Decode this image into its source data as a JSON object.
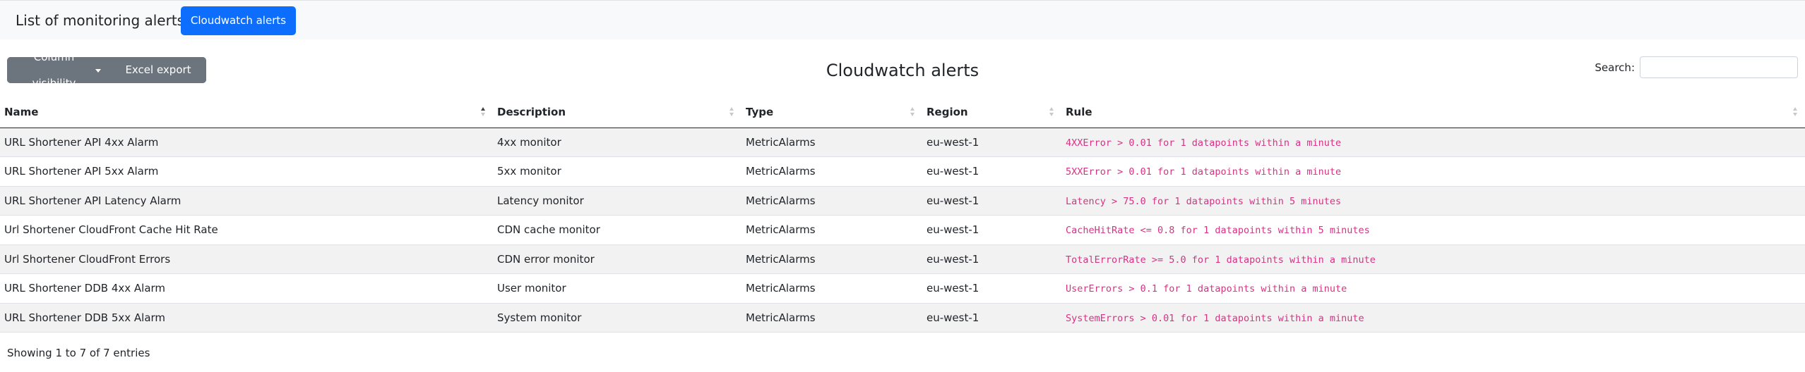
{
  "navbar": {
    "brand": "List of monitoring alerts",
    "nav_button": "Cloudwatch alerts"
  },
  "toolbar": {
    "column_visibility_label": "Column visibility",
    "excel_export_label": "Excel export"
  },
  "table_title": "Cloudwatch alerts",
  "search": {
    "label": "Search:",
    "value": ""
  },
  "table": {
    "columns": [
      "Name",
      "Description",
      "Type",
      "Region",
      "Rule"
    ],
    "sorted_column": "Name",
    "sort_direction": "asc",
    "rows": [
      [
        "URL Shortener API 4xx Alarm",
        "4xx monitor",
        "MetricAlarms",
        "eu-west-1",
        "4XXError > 0.01 for 1 datapoints within a minute"
      ],
      [
        "URL Shortener API 5xx Alarm",
        "5xx monitor",
        "MetricAlarms",
        "eu-west-1",
        "5XXError > 0.01 for 1 datapoints within a minute"
      ],
      [
        "URL Shortener API Latency Alarm",
        "Latency monitor",
        "MetricAlarms",
        "eu-west-1",
        "Latency > 75.0 for 1 datapoints within 5 minutes"
      ],
      [
        "Url Shortener CloudFront Cache Hit Rate",
        "CDN cache monitor",
        "MetricAlarms",
        "eu-west-1",
        "CacheHitRate <= 0.8 for 1 datapoints within 5 minutes"
      ],
      [
        "Url Shortener CloudFront Errors",
        "CDN error monitor",
        "MetricAlarms",
        "eu-west-1",
        "TotalErrorRate >= 5.0 for 1 datapoints within a minute"
      ],
      [
        "URL Shortener DDB 4xx Alarm",
        "User monitor",
        "MetricAlarms",
        "eu-west-1",
        "UserErrors > 0.1 for 1 datapoints within a minute"
      ],
      [
        "URL Shortener DDB 5xx Alarm",
        "System monitor",
        "MetricAlarms",
        "eu-west-1",
        "SystemErrors > 0.01 for 1 datapoints within a minute"
      ]
    ]
  },
  "info_text": "Showing 1 to 7 of 7 entries",
  "colors": {
    "primary": "#0d6efd",
    "secondary": "#6c757d",
    "rule_code": "#d63384",
    "navbar_bg": "#f8f9fa"
  }
}
